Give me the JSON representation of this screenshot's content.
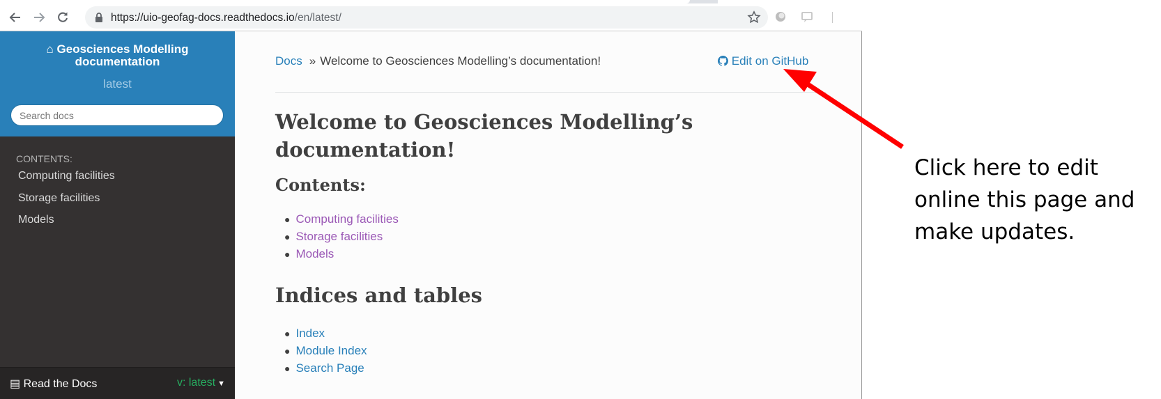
{
  "browser": {
    "url_main": "https://uio-geofag-docs.readthedocs.io",
    "url_path": "/en/latest/"
  },
  "sidebar": {
    "project_title": "Geosciences Modelling documentation",
    "version": "latest",
    "search_placeholder": "Search docs",
    "caption": "CONTENTS:",
    "items": [
      {
        "label": "Computing facilities"
      },
      {
        "label": "Storage facilities"
      },
      {
        "label": "Models"
      }
    ],
    "footer_brand": "Read the Docs",
    "footer_version": "v: latest"
  },
  "breadcrumb": {
    "home": "Docs",
    "separator": "»",
    "current": "Welcome to Geosciences Modelling’s documentation!"
  },
  "edit_link": "Edit on GitHub",
  "page": {
    "title": "Welcome to Geosciences Modelling’s documentation!",
    "contents_heading": "Contents:",
    "contents": [
      {
        "label": "Computing facilities"
      },
      {
        "label": "Storage facilities"
      },
      {
        "label": "Models"
      }
    ],
    "indices_heading": "Indices and tables",
    "indices": [
      {
        "label": "Index"
      },
      {
        "label": "Module Index"
      },
      {
        "label": "Search Page"
      }
    ]
  },
  "annotation": {
    "text": "Click here to edit online this page and make updates."
  },
  "colors": {
    "rtd_blue": "#2980b9",
    "sidebar_dark": "#343131",
    "visited_link": "#9b59b6",
    "arrow_red": "#ff0000"
  }
}
